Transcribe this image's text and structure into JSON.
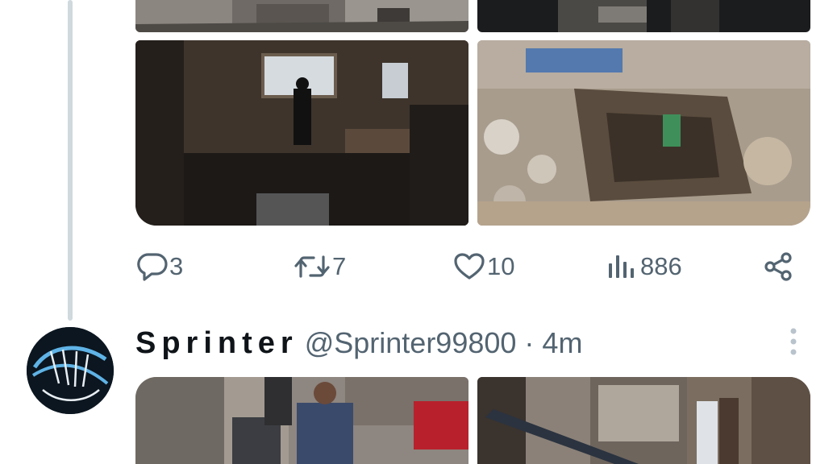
{
  "previous_tweet": {
    "actions": {
      "replies": "3",
      "retweets": "7",
      "likes": "10",
      "views": "886"
    },
    "icons": [
      "reply-icon",
      "retweet-icon",
      "like-icon",
      "views-icon",
      "share-icon"
    ]
  },
  "next_tweet": {
    "display_name": "Sprinter",
    "handle": "@Sprinter99800",
    "separator": "·",
    "time": "4m",
    "menu_icon": "more-vertical-icon"
  },
  "colors": {
    "text_primary": "#0f1419",
    "text_secondary": "#536471",
    "thread_line": "#cfd9de",
    "menu_dots": "#b9c3cc"
  }
}
